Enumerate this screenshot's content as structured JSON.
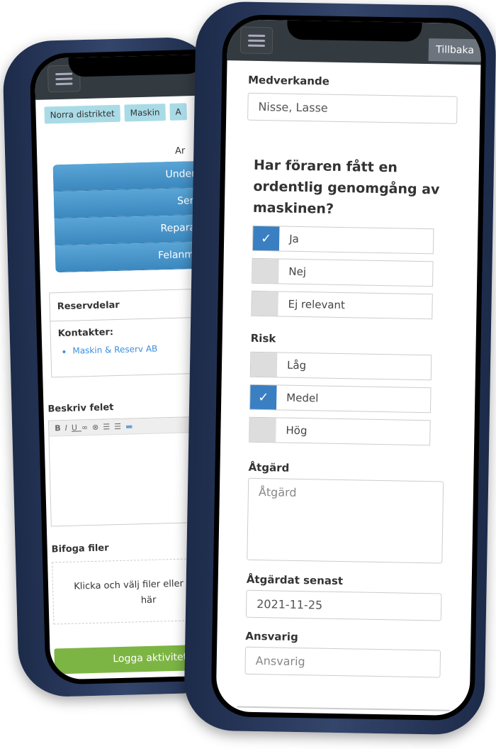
{
  "back_phone": {
    "tags": [
      "Norra distriktet",
      "Maskin",
      "A"
    ],
    "partial_text": "Ar",
    "menu": [
      "Underhåll",
      "Service",
      "Reparation",
      "Felanmälan"
    ],
    "panel": {
      "title": "Reservdelar",
      "contacts_label": "Kontakter:",
      "contacts": [
        "Maskin & Reserv AB"
      ]
    },
    "describe_label": "Beskriv felet",
    "editor_tools": [
      "B",
      "I",
      "U",
      "link",
      "unlink",
      "ordered-list",
      "unordered-list",
      "image"
    ],
    "attach_label": "Bifoga filer",
    "drop_text": "Klicka och välj filer eller dra filer här",
    "submit": "Logga aktivitet",
    "colors": {
      "submit": "#7db544",
      "menu": "#4a97cc",
      "tag": "#a9dbe6"
    }
  },
  "front_phone": {
    "back_button": "Tillbaka",
    "participants_label": "Medverkande",
    "participants_value": "Nisse, Lasse",
    "question": "Har föraren fått en ordentlig genomgång av maskinen?",
    "question_options": [
      {
        "label": "Ja",
        "checked": true
      },
      {
        "label": "Nej",
        "checked": false
      },
      {
        "label": "Ej relevant",
        "checked": false
      }
    ],
    "risk_label": "Risk",
    "risk_options": [
      {
        "label": "Låg",
        "checked": false
      },
      {
        "label": "Medel",
        "checked": true
      },
      {
        "label": "Hög",
        "checked": false
      }
    ],
    "action_label": "Åtgärd",
    "action_placeholder": "Åtgärd",
    "deadline_label": "Åtgärdat senast",
    "deadline_value": "2021-11-25",
    "responsible_label": "Ansvarig",
    "responsible_placeholder": "Ansvarig",
    "colors": {
      "checked": "#3a7fc1"
    }
  }
}
